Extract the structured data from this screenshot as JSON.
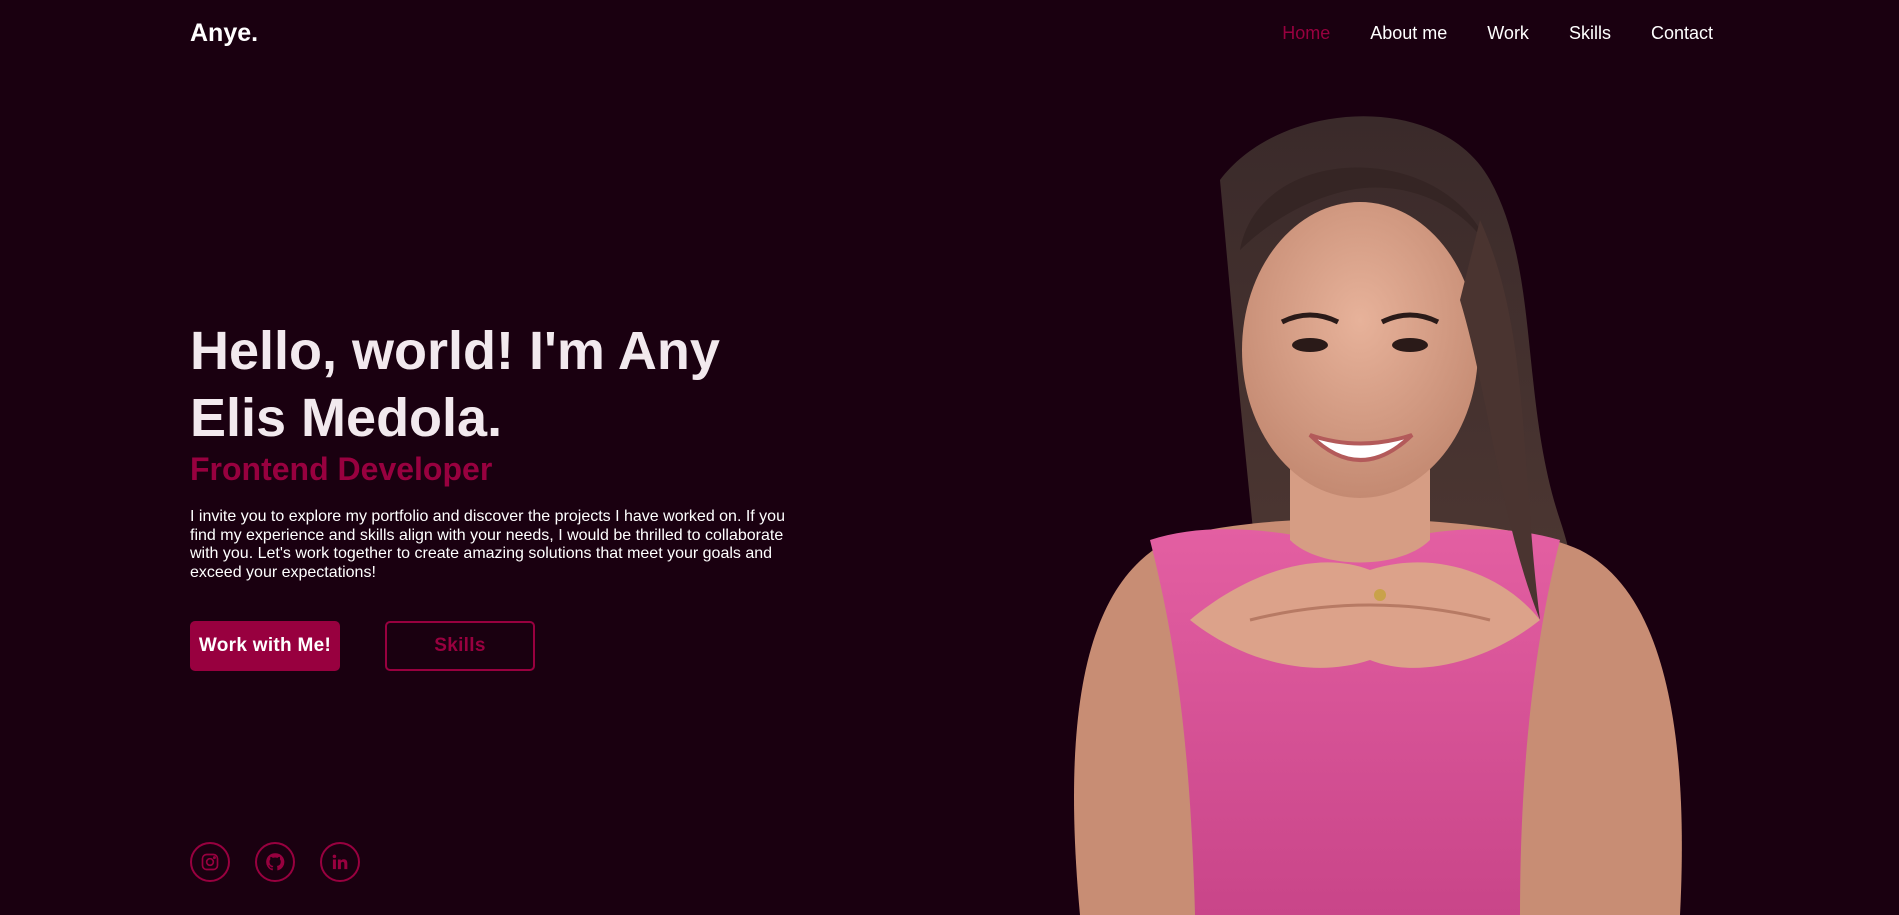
{
  "header": {
    "logo": "Anye.",
    "nav": [
      {
        "label": "Home",
        "active": true
      },
      {
        "label": "About me",
        "active": false
      },
      {
        "label": "Work",
        "active": false
      },
      {
        "label": "Skills",
        "active": false
      },
      {
        "label": "Contact",
        "active": false
      }
    ]
  },
  "hero": {
    "title": "Hello, world! I'm Any Elis Medola.",
    "role": "Frontend Developer",
    "description": "I invite you to explore my portfolio and discover the projects I have worked on. If you find my experience and skills align with your needs, I would be thrilled to collaborate with you. Let's work together to create amazing solutions that meet your goals and exceed your expectations!",
    "primary_button": "Work with Me!",
    "secondary_button": "Skills"
  },
  "socials": [
    {
      "icon": "instagram-icon"
    },
    {
      "icon": "github-icon"
    },
    {
      "icon": "linkedin-icon"
    }
  ],
  "colors": {
    "background": "#1a0010",
    "accent": "#98003f",
    "text": "#ffffff"
  }
}
